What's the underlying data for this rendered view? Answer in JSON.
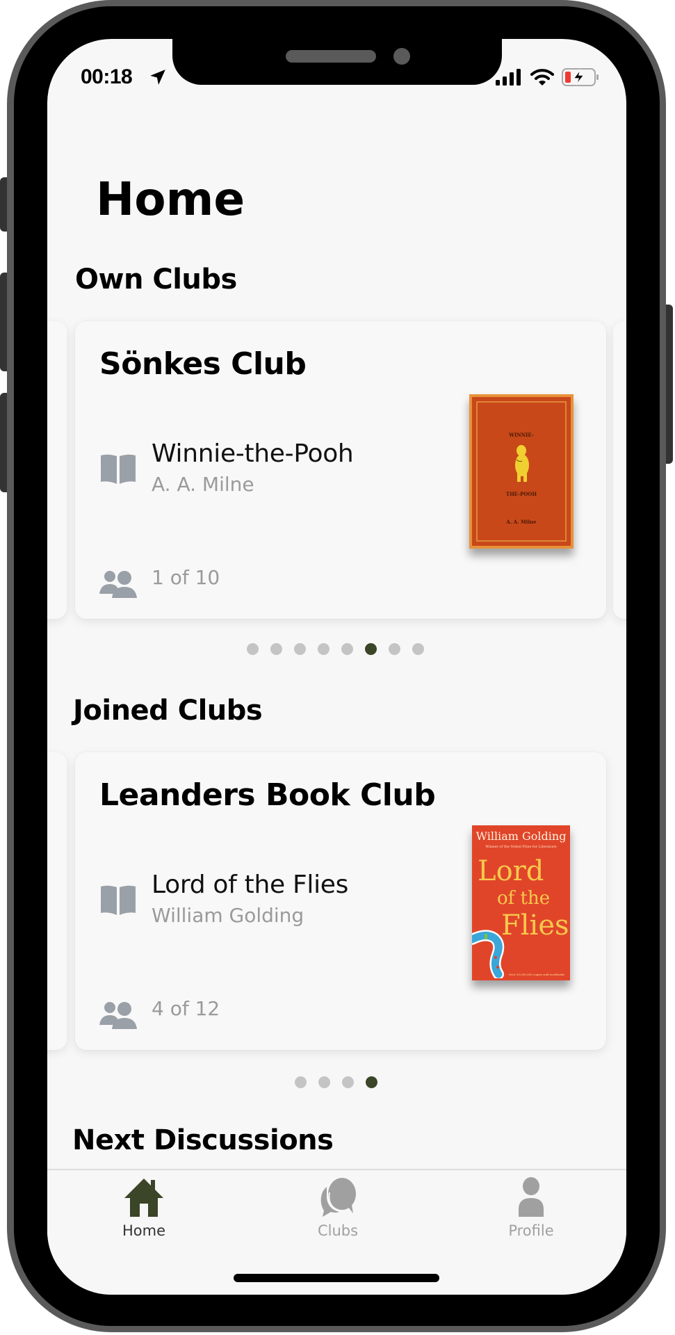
{
  "status_bar": {
    "time": "00:18",
    "location_icon": "location-arrow-icon",
    "signal_icon": "cellular-signal-icon",
    "wifi_icon": "wifi-icon",
    "battery_icon": "battery-charging-low-icon"
  },
  "page": {
    "title": "Home"
  },
  "own_clubs": {
    "heading": "Own Clubs",
    "card": {
      "club_name": "Sönkes Club",
      "book_title": "Winnie-the-Pooh",
      "book_author": "A. A. Milne",
      "members": "1 of 10",
      "cover": {
        "top": "WINNIE-",
        "middle": "THE-POOH",
        "bottom": "A. A. Milne",
        "colors": {
          "background": "#c8481a",
          "border": "#e8923a"
        }
      }
    },
    "pagination": {
      "count": 8,
      "active_index": 5
    }
  },
  "joined_clubs": {
    "heading": "Joined Clubs",
    "card": {
      "club_name": "Leanders Book Club",
      "book_title": "Lord of the Flies",
      "book_author": "William Golding",
      "members": "4 of 12",
      "cover": {
        "author": "William Golding",
        "award": "Winner of the Nobel Prize for Literature",
        "title_line1": "Lord",
        "title_line2": "of the",
        "title_line3": "Flies",
        "footer": "Over 10,000,000 copies sold worldwide",
        "colors": {
          "background": "#e0452a",
          "title": "#f7c94c"
        }
      }
    },
    "pagination": {
      "count": 4,
      "active_index": 3
    }
  },
  "next_discussions": {
    "heading": "Next Discussions"
  },
  "tab_bar": {
    "items": [
      {
        "label": "Home",
        "icon": "home-icon",
        "active": true
      },
      {
        "label": "Clubs",
        "icon": "chat-bubbles-icon",
        "active": false
      },
      {
        "label": "Profile",
        "icon": "person-icon",
        "active": false
      }
    ]
  },
  "colors": {
    "accent": "#3b4527",
    "inactive": "#a0a0a0",
    "muted_text": "#9a9a9a",
    "background": "#f7f7f7",
    "dot_inactive": "#c4c4c4"
  }
}
